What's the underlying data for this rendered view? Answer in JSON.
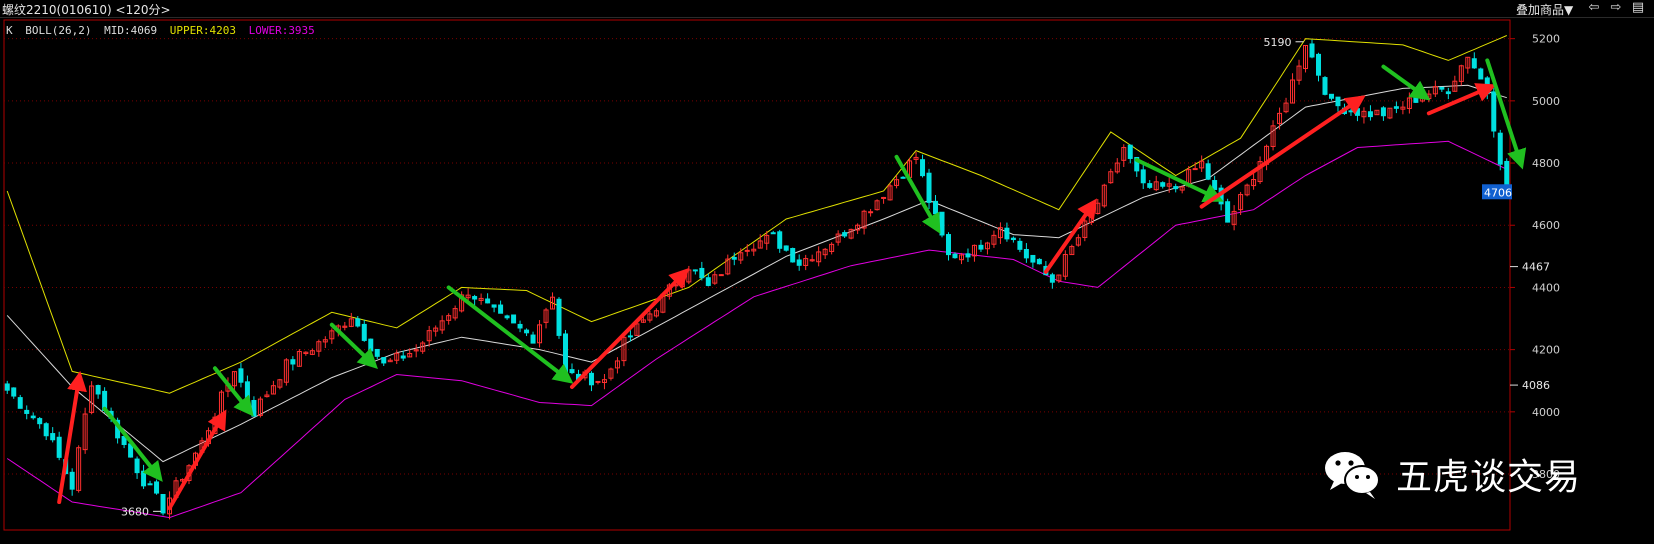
{
  "window": {
    "title": "螺纹2210(010610) <120分>",
    "overlay_label": "叠加商品▼"
  },
  "indicator": {
    "k_label": "K",
    "boll_label": "BOLL(26,2)",
    "mid_label": "MID:4069",
    "upper_label": "UPPER:4203",
    "lower_label": "LOWER:3935",
    "upper_color": "#e0e000",
    "lower_color": "#e000e0",
    "mid_color": "#d8d8d8"
  },
  "watermark": {
    "text": "五虎谈交易",
    "icon": "wechat-icon"
  },
  "colors": {
    "up": "#ff3030",
    "down": "#00e0e0",
    "grid": "#7a0000",
    "axis": "#b00000"
  },
  "chart_data": {
    "type": "candlestick",
    "title": "",
    "y_ticks": [
      3800,
      4000,
      4200,
      4400,
      4600,
      4800,
      5000,
      5200
    ],
    "y_range": [
      3620,
      5260
    ],
    "marked_levels": [
      {
        "value": 4467,
        "label": "4467"
      },
      {
        "value": 4086,
        "label": "4086"
      }
    ],
    "last_price": {
      "value": 4706,
      "label": "4706"
    },
    "annotations": [
      {
        "label": "3680",
        "value": 3680,
        "bar": 24
      },
      {
        "label": "5190",
        "value": 5190,
        "bar": 200
      }
    ],
    "close_anchors": [
      [
        0,
        4070
      ],
      [
        6,
        3940
      ],
      [
        10,
        3760
      ],
      [
        13,
        4100
      ],
      [
        17,
        3930
      ],
      [
        21,
        3780
      ],
      [
        24,
        3690
      ],
      [
        30,
        3900
      ],
      [
        35,
        4140
      ],
      [
        38,
        4000
      ],
      [
        43,
        4150
      ],
      [
        50,
        4250
      ],
      [
        53,
        4310
      ],
      [
        58,
        4150
      ],
      [
        63,
        4200
      ],
      [
        71,
        4390
      ],
      [
        76,
        4300
      ],
      [
        81,
        4240
      ],
      [
        84,
        4380
      ],
      [
        86,
        4120
      ],
      [
        92,
        4100
      ],
      [
        95,
        4220
      ],
      [
        100,
        4340
      ],
      [
        105,
        4470
      ],
      [
        108,
        4400
      ],
      [
        113,
        4530
      ],
      [
        118,
        4560
      ],
      [
        122,
        4480
      ],
      [
        128,
        4560
      ],
      [
        133,
        4660
      ],
      [
        137,
        4750
      ],
      [
        140,
        4820
      ],
      [
        142,
        4680
      ],
      [
        145,
        4500
      ],
      [
        149,
        4520
      ],
      [
        153,
        4600
      ],
      [
        157,
        4500
      ],
      [
        161,
        4420
      ],
      [
        165,
        4560
      ],
      [
        169,
        4710
      ],
      [
        172,
        4850
      ],
      [
        175,
        4720
      ],
      [
        180,
        4720
      ],
      [
        184,
        4800
      ],
      [
        188,
        4610
      ],
      [
        191,
        4720
      ],
      [
        195,
        4900
      ],
      [
        198,
        5060
      ],
      [
        200,
        5190
      ],
      [
        204,
        4990
      ],
      [
        209,
        4960
      ],
      [
        213,
        4960
      ],
      [
        218,
        5020
      ],
      [
        222,
        5040
      ],
      [
        225,
        5150
      ],
      [
        228,
        5030
      ],
      [
        231,
        4706
      ]
    ],
    "boll_bands": {
      "upper": [
        [
          0,
          4710
        ],
        [
          10,
          4130
        ],
        [
          25,
          4060
        ],
        [
          36,
          4160
        ],
        [
          50,
          4320
        ],
        [
          60,
          4270
        ],
        [
          70,
          4400
        ],
        [
          80,
          4390
        ],
        [
          90,
          4290
        ],
        [
          105,
          4400
        ],
        [
          120,
          4620
        ],
        [
          135,
          4710
        ],
        [
          140,
          4840
        ],
        [
          150,
          4760
        ],
        [
          162,
          4650
        ],
        [
          170,
          4900
        ],
        [
          180,
          4760
        ],
        [
          190,
          4880
        ],
        [
          200,
          5200
        ],
        [
          215,
          5180
        ],
        [
          222,
          5130
        ],
        [
          231,
          5210
        ]
      ],
      "mid": [
        [
          0,
          4310
        ],
        [
          10,
          4080
        ],
        [
          24,
          3840
        ],
        [
          36,
          3960
        ],
        [
          50,
          4110
        ],
        [
          60,
          4190
        ],
        [
          70,
          4240
        ],
        [
          82,
          4200
        ],
        [
          90,
          4160
        ],
        [
          105,
          4330
        ],
        [
          120,
          4500
        ],
        [
          135,
          4620
        ],
        [
          142,
          4680
        ],
        [
          155,
          4570
        ],
        [
          162,
          4560
        ],
        [
          175,
          4690
        ],
        [
          185,
          4750
        ],
        [
          200,
          4980
        ],
        [
          215,
          5040
        ],
        [
          225,
          5050
        ],
        [
          231,
          5010
        ]
      ],
      "lower": [
        [
          0,
          3850
        ],
        [
          10,
          3710
        ],
        [
          25,
          3660
        ],
        [
          36,
          3740
        ],
        [
          52,
          4040
        ],
        [
          60,
          4120
        ],
        [
          70,
          4100
        ],
        [
          82,
          4030
        ],
        [
          90,
          4020
        ],
        [
          100,
          4170
        ],
        [
          115,
          4370
        ],
        [
          130,
          4470
        ],
        [
          142,
          4520
        ],
        [
          155,
          4490
        ],
        [
          162,
          4420
        ],
        [
          168,
          4400
        ],
        [
          180,
          4600
        ],
        [
          192,
          4650
        ],
        [
          200,
          4760
        ],
        [
          208,
          4850
        ],
        [
          222,
          4870
        ],
        [
          231,
          4780
        ]
      ]
    },
    "arrows": [
      {
        "color": "red",
        "from": [
          8,
          3710
        ],
        "to": [
          11,
          4100
        ]
      },
      {
        "color": "green",
        "from": [
          15,
          4010
        ],
        "to": [
          23,
          3800
        ]
      },
      {
        "color": "red",
        "from": [
          25,
          3690
        ],
        "to": [
          33,
          3980
        ]
      },
      {
        "color": "green",
        "from": [
          32,
          4140
        ],
        "to": [
          37,
          4010
        ]
      },
      {
        "color": "green",
        "from": [
          50,
          4280
        ],
        "to": [
          56,
          4160
        ]
      },
      {
        "color": "green",
        "from": [
          68,
          4400
        ],
        "to": [
          86,
          4110
        ]
      },
      {
        "color": "red",
        "from": [
          87,
          4080
        ],
        "to": [
          104,
          4440
        ]
      },
      {
        "color": "green",
        "from": [
          137,
          4820
        ],
        "to": [
          143,
          4600
        ]
      },
      {
        "color": "red",
        "from": [
          160,
          4450
        ],
        "to": [
          167,
          4660
        ]
      },
      {
        "color": "green",
        "from": [
          174,
          4810
        ],
        "to": [
          186,
          4690
        ]
      },
      {
        "color": "red",
        "from": [
          184,
          4660
        ],
        "to": [
          208,
          5000
        ]
      },
      {
        "color": "green",
        "from": [
          212,
          5110
        ],
        "to": [
          218,
          5020
        ]
      },
      {
        "color": "red",
        "from": [
          219,
          4960
        ],
        "to": [
          228,
          5040
        ]
      },
      {
        "color": "green",
        "from": [
          228,
          5130
        ],
        "to": [
          233,
          4810
        ]
      }
    ]
  }
}
